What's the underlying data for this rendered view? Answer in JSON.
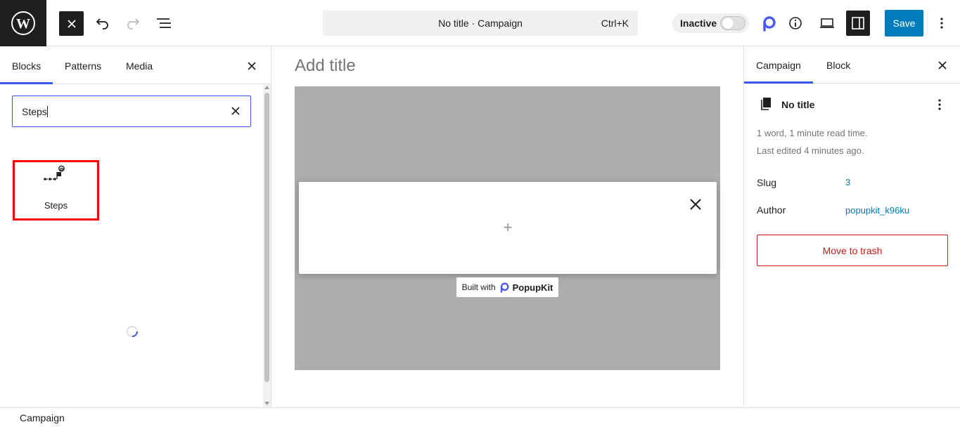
{
  "header": {
    "command_title": "No title · Campaign",
    "command_shortcut": "Ctrl+K",
    "status_label": "Inactive",
    "save_label": "Save"
  },
  "inserter": {
    "tabs": [
      "Blocks",
      "Patterns",
      "Media"
    ],
    "active_tab": "Blocks",
    "search_value": "Steps",
    "results": [
      {
        "label": "Steps",
        "icon": "steps-flag-icon"
      }
    ]
  },
  "canvas": {
    "title_placeholder": "Add title",
    "built_with_prefix": "Built with",
    "built_with_brand": "PopupKit"
  },
  "sidebar": {
    "tabs": [
      "Campaign",
      "Block"
    ],
    "active_tab": "Campaign",
    "doc_title": "No title",
    "stats": "1 word, 1 minute read time.",
    "last_edited": "Last edited 4 minutes ago.",
    "slug_label": "Slug",
    "slug_value": "3",
    "author_label": "Author",
    "author_value": "popupkit_k96ku",
    "trash_label": "Move to trash"
  },
  "footer": {
    "breadcrumb": "Campaign"
  },
  "colors": {
    "accent": "#3858e9",
    "primary_button": "#007cba",
    "danger": "#cc1818",
    "highlight_box": "#ff0000"
  }
}
